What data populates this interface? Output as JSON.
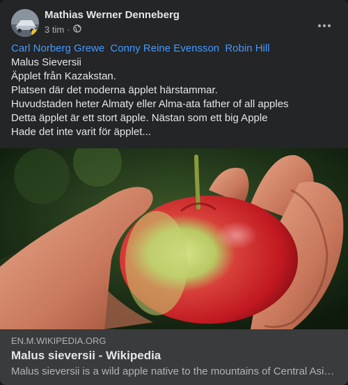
{
  "post": {
    "author": "Mathias Werner Denneberg",
    "time": "3 tim",
    "time_separator": "·",
    "audience_icon": "globe-icon",
    "tags": [
      "Carl Norberg Grewe",
      "Conny Reine Evensson",
      "Robin Hill"
    ],
    "lines": [
      "Malus Sieversii",
      "Äpplet från Kazakstan.",
      "Platsen där det moderna äpplet härstammar.",
      "Huvudstaden heter Almaty eller Alma-ata father of all apples",
      "Detta äpplet är ett stort äpple. Nästan som ett big Apple",
      "Hade det inte varit för äpplet..."
    ]
  },
  "link_preview": {
    "domain": "EN.M.WIKIPEDIA.ORG",
    "title": "Malus sieversii - Wikipedia",
    "description": "Malus sieversii is a wild apple native to the mountains of Central Asia in southern Kazakhstan, Kyrgyzstan, Tajikistan, and Xinjiang, China."
  },
  "colors": {
    "card_bg": "#242526",
    "link_bg": "#3a3b3c",
    "tag_link": "#4599ff",
    "primary_text": "#e4e6eb",
    "secondary_text": "#b0b3b8"
  }
}
